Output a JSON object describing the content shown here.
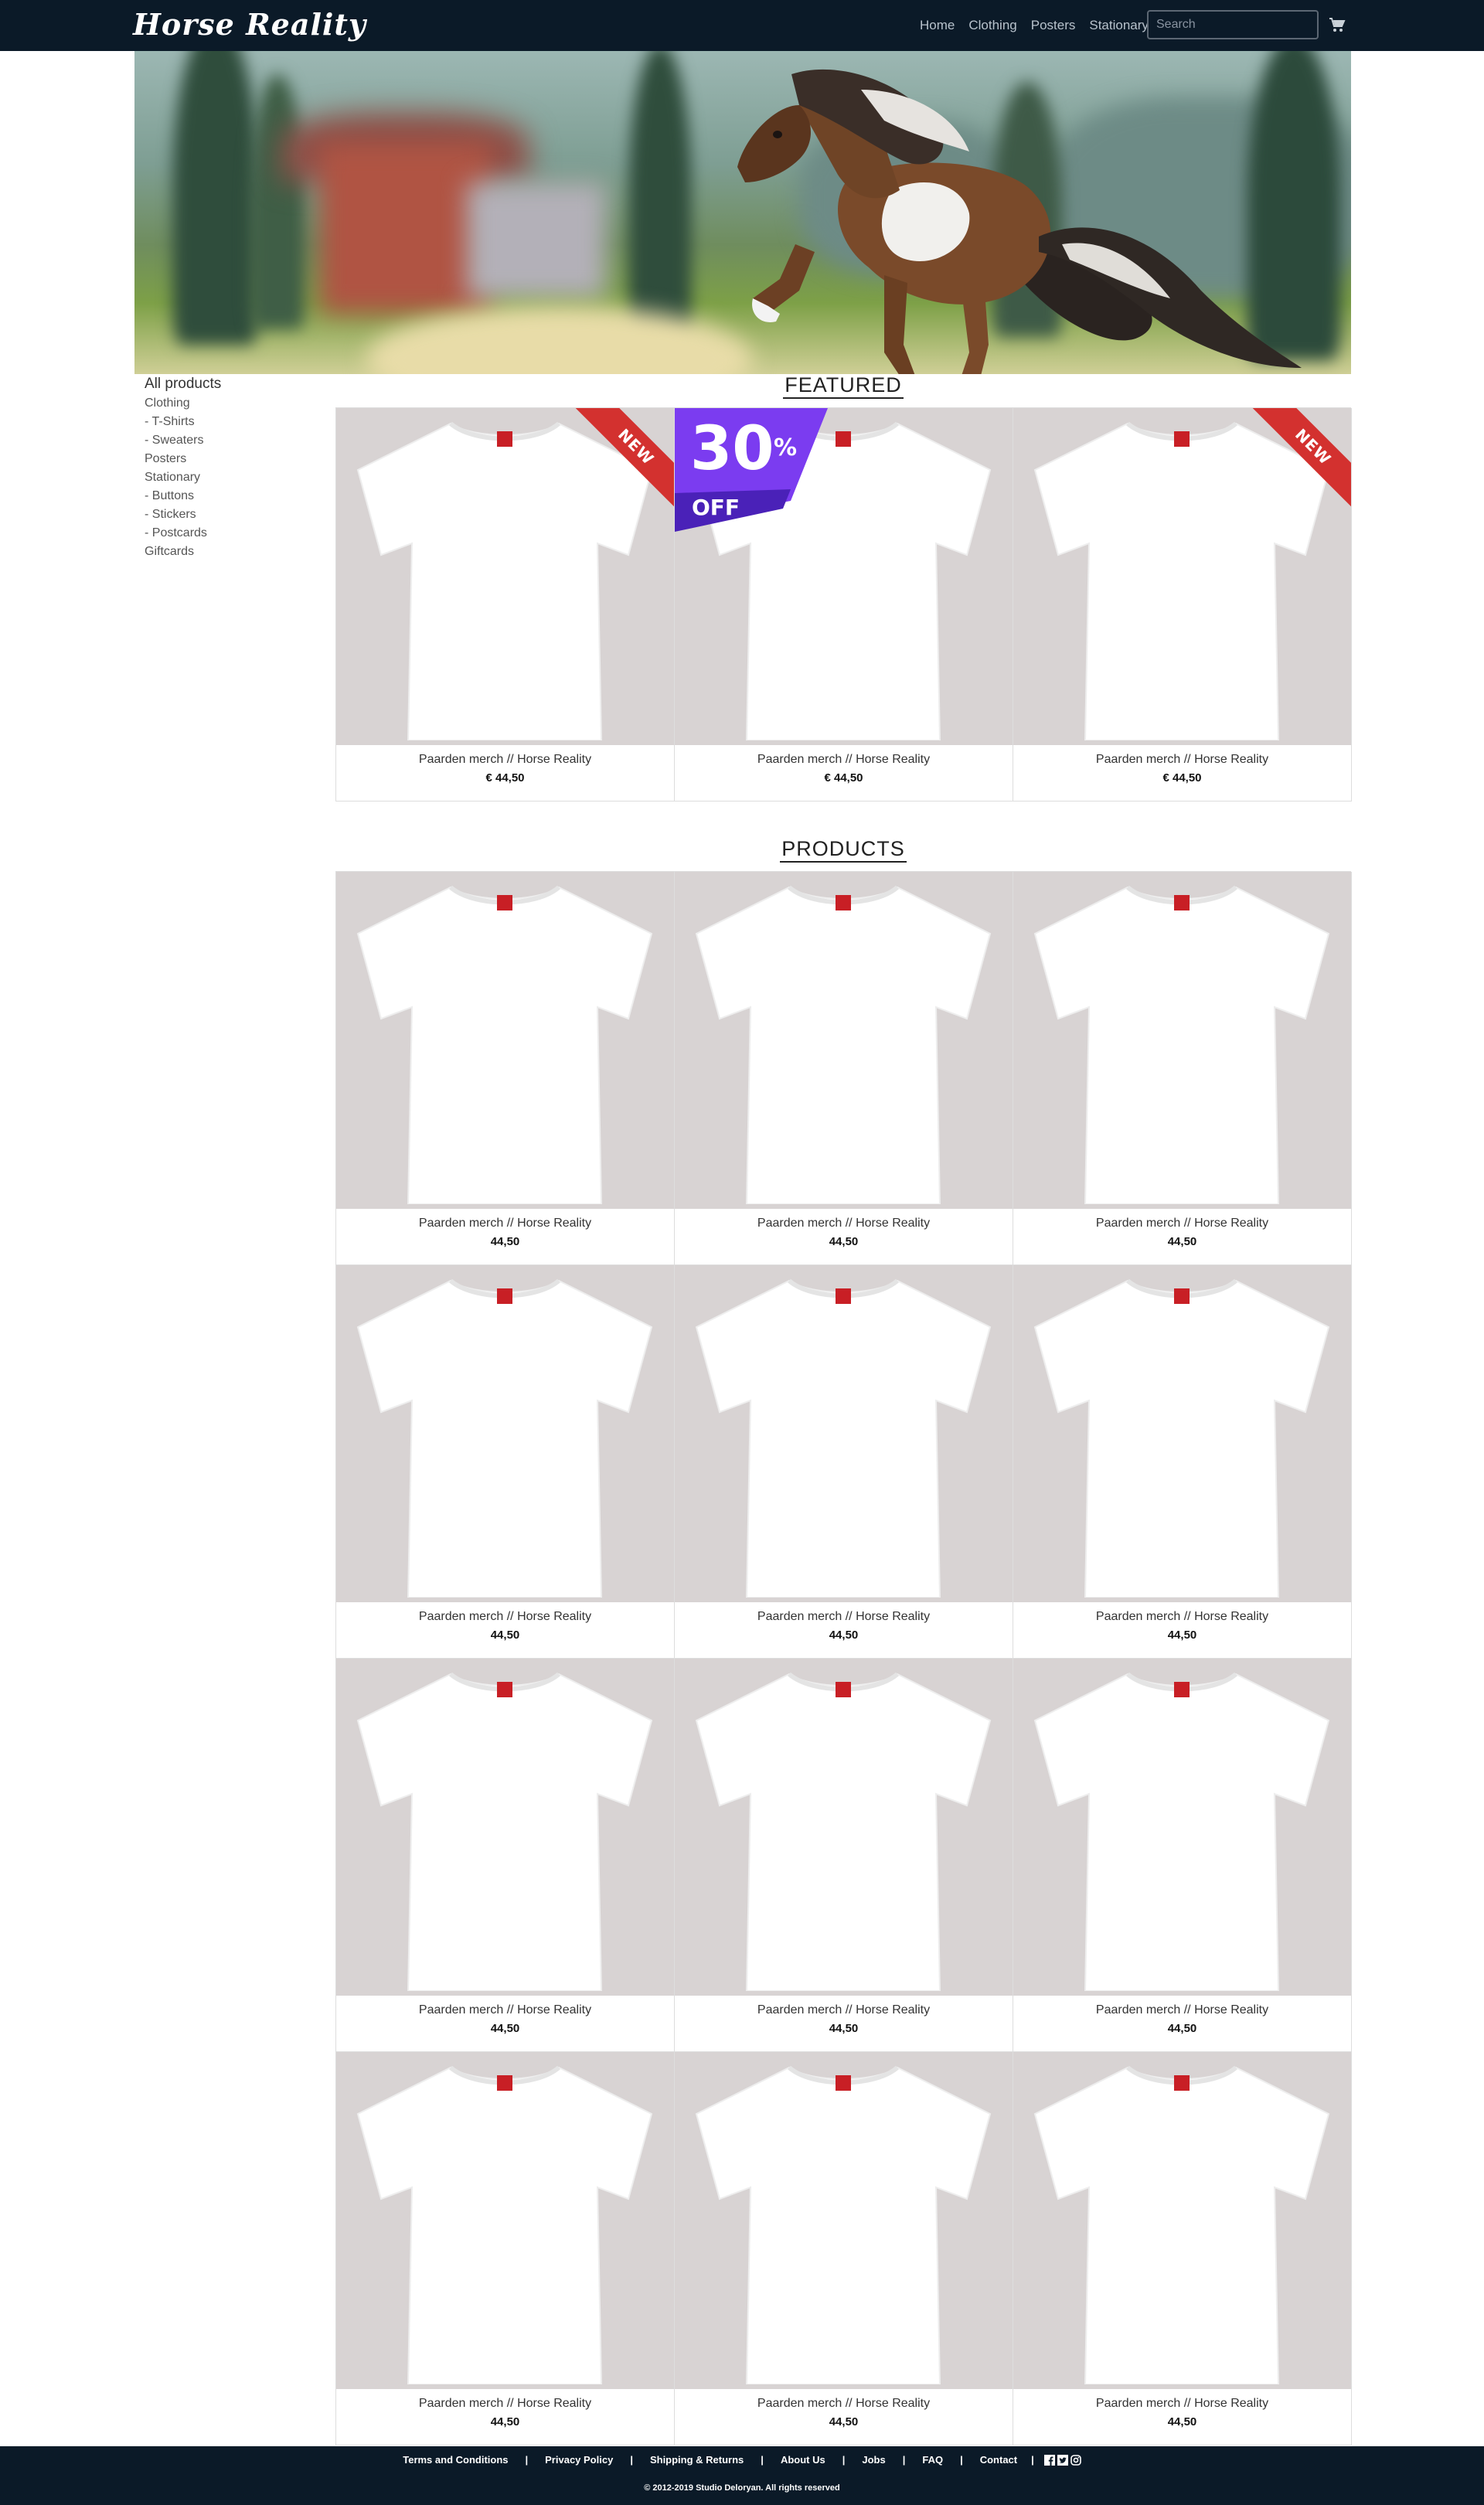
{
  "brand": {
    "logo_text": "Horse Reality"
  },
  "nav": {
    "links": [
      "Home",
      "Clothing",
      "Posters",
      "Stationary"
    ],
    "search_placeholder": "Search",
    "cart_icon": "shopping-cart-icon"
  },
  "sidebar": {
    "title": "All products",
    "items": [
      "Clothing",
      "- T-Shirts",
      "- Sweaters",
      "Posters",
      "Stationary",
      "- Buttons",
      "- Stickers",
      "- Postcards",
      "Giftcards"
    ]
  },
  "featured": {
    "title": "FEATURED",
    "products": [
      {
        "name": "Paarden merch // Horse Reality",
        "price": "€ 44,50",
        "badge": "NEW"
      },
      {
        "name": "Paarden merch // Horse Reality",
        "price": "€ 44,50",
        "discount_number": "30",
        "discount_percent": "%",
        "discount_off": "OFF"
      },
      {
        "name": "Paarden merch // Horse Reality",
        "price": "€ 44,50",
        "badge": "NEW"
      }
    ]
  },
  "products": {
    "title": "PRODUCTS",
    "items": [
      {
        "name": "Paarden merch // Horse Reality",
        "price": "44,50"
      },
      {
        "name": "Paarden merch // Horse Reality",
        "price": "44,50"
      },
      {
        "name": "Paarden merch // Horse Reality",
        "price": "44,50"
      },
      {
        "name": "Paarden merch // Horse Reality",
        "price": "44,50"
      },
      {
        "name": "Paarden merch // Horse Reality",
        "price": "44,50"
      },
      {
        "name": "Paarden merch // Horse Reality",
        "price": "44,50"
      },
      {
        "name": "Paarden merch // Horse Reality",
        "price": "44,50"
      },
      {
        "name": "Paarden merch // Horse Reality",
        "price": "44,50"
      },
      {
        "name": "Paarden merch // Horse Reality",
        "price": "44,50"
      },
      {
        "name": "Paarden merch // Horse Reality",
        "price": "44,50"
      },
      {
        "name": "Paarden merch // Horse Reality",
        "price": "44,50"
      },
      {
        "name": "Paarden merch // Horse Reality",
        "price": "44,50"
      }
    ]
  },
  "footer": {
    "links": [
      "Terms and Conditions",
      "Privacy Policy",
      "Shipping & Returns",
      "About Us",
      "Jobs",
      "FAQ",
      "Contact"
    ],
    "separator": "|",
    "social_icons": [
      "facebook-icon",
      "twitter-icon",
      "instagram-icon"
    ],
    "copyright": "© 2012-2019 Studio Deloryan. All rights reserved"
  },
  "colors": {
    "navbar_bg": "#0b1a28",
    "product_bg": "#d8d3d3",
    "new_ribbon": "#d3312f",
    "discount_purple": "#7b3cf0"
  }
}
